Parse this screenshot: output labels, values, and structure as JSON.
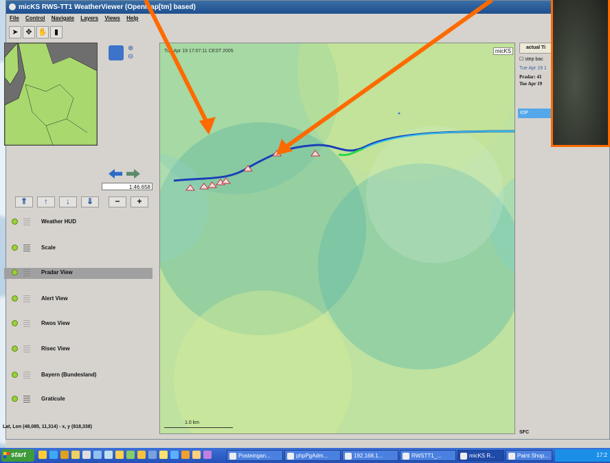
{
  "window": {
    "title": "micKS RWS-TT1 WeatherViewer (OpenMap[tm] based)",
    "menu": [
      "File",
      "Control",
      "Navigate",
      "Layers",
      "Views",
      "Help"
    ]
  },
  "toolbar": {
    "tools": [
      "select-arrow-icon",
      "pan-cross-icon",
      "hand-icon",
      "figure-icon"
    ]
  },
  "navigation": {
    "scale_value": "1:46.658"
  },
  "layer_controls": {
    "buttons": [
      "move-top-icon",
      "move-up-icon",
      "move-down-icon",
      "move-bottom-icon",
      "remove-icon",
      "add-icon"
    ],
    "button_glyphs": [
      "⇑",
      "↑",
      "↓",
      "⇓",
      "−",
      "+"
    ]
  },
  "layers": [
    {
      "label": "Weather HUD",
      "icon": "empty-list-icon",
      "selected": false
    },
    {
      "label": "Scale",
      "icon": "list-icon",
      "selected": false
    },
    {
      "label": "Pradar View",
      "icon": "empty-list-icon",
      "selected": true
    },
    {
      "label": "Alert View",
      "icon": "empty-list-icon",
      "selected": false
    },
    {
      "label": "Rwos View",
      "icon": "empty-list-icon",
      "selected": false
    },
    {
      "label": "Risec View",
      "icon": "empty-list-icon",
      "selected": false
    },
    {
      "label": "Bayern (Bundesland)",
      "icon": "empty-list-icon",
      "selected": false
    },
    {
      "label": "Graticule",
      "icon": "list-icon",
      "selected": false
    }
  ],
  "map": {
    "timestamp": "Tue Apr 19 17:07:11 CEST 2005",
    "logo": "micKS",
    "scale_label": "1.0 km"
  },
  "right_panel": {
    "tab": "actual Ti",
    "checkbox_label": "step bac",
    "line1": "Tue Apr 19 1",
    "line2": "Pradar: 41",
    "line3": "Tue Apr 19",
    "iop": "IOP",
    "sfc": "SFC"
  },
  "status": {
    "coords": "Lat, Lon (48,085, 11,314) - x, y (818,338)"
  },
  "taskbar": {
    "start": "start",
    "tasks": [
      {
        "label": "Posteingan...",
        "active": false
      },
      {
        "label": "phpPgAdm...",
        "active": false
      },
      {
        "label": "192.168.1...",
        "active": false
      },
      {
        "label": "RWSTT1_...",
        "active": false
      },
      {
        "label": "micKS R...",
        "active": true
      },
      {
        "label": "Paint Shop...",
        "active": false
      }
    ],
    "clock": "17:2"
  },
  "colors": {
    "annotation": "#ff6a00",
    "route_blue": "#1b3fb8",
    "route_cyan": "#33c0e8",
    "route_green": "#2ad84a"
  }
}
